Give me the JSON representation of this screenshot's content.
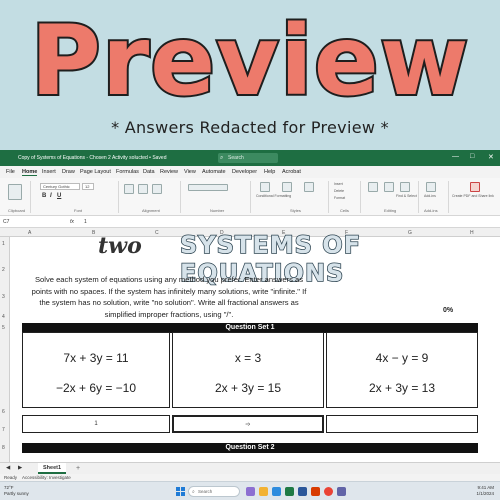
{
  "banner": {
    "title": "Preview",
    "subtitle": "* Answers Redacted for Preview *"
  },
  "window": {
    "doc_title": "Copy of Systems of Equations - Chosen 2 Activity solucted • Saved",
    "search_placeholder": "Search",
    "controls": [
      "—",
      "□",
      "✕"
    ]
  },
  "menu": {
    "tabs": [
      "File",
      "Home",
      "Insert",
      "Draw",
      "Page Layout",
      "Formulas",
      "Data",
      "Review",
      "View",
      "Automate",
      "Developer",
      "Help",
      "Acrobat"
    ],
    "active": "Home"
  },
  "ribbon": {
    "font_name": "Century Gothic",
    "font_size": "12",
    "groups": [
      "Clipboard",
      "Font",
      "Alignment",
      "Number",
      "Styles",
      "Cells",
      "Editing",
      "Add-ins"
    ],
    "buttons": [
      "Conditional Formatting",
      "Format as Table",
      "Cell Styles",
      "Insert",
      "Delete",
      "Format",
      "Sort & Filter",
      "Find & Select",
      "Add-ins",
      "Create PDF and Share link"
    ]
  },
  "formula_bar": {
    "cell_ref": "C7",
    "fx": "fx",
    "value": "1"
  },
  "columns": [
    "A",
    "B",
    "C",
    "D",
    "E",
    "F",
    "G",
    "H"
  ],
  "rows": [
    "1",
    "2",
    "3",
    "4",
    "5",
    "6",
    "7",
    "8"
  ],
  "worksheet": {
    "logo_text": "two",
    "title": "SYSTEMS OF EQUATIONS",
    "instructions": [
      "Solve each system of equations using any method you prefer. Enter answers as",
      "points with no spaces.  If the system has infinitely many solutions, write \"infinite.\" If",
      "the system has no solution, write \"no solution\".  Write all fractional answers as",
      "simplified improper fractions, using \"/\"."
    ],
    "percent": "0%",
    "question_sets": [
      "Question Set 1",
      "Question Set 2"
    ],
    "systems": [
      {
        "eq1": "7x + 3y = 11",
        "eq2": "−2x + 6y = −10",
        "answer": "1"
      },
      {
        "eq1": "x = 3",
        "eq2": "2x + 3y = 15",
        "answer": ""
      },
      {
        "eq1": "4x − y = 9",
        "eq2": "2x + 3y = 13",
        "answer": ""
      }
    ]
  },
  "sheet_tabs": {
    "active": "Sheet1",
    "add": "+"
  },
  "status": {
    "ready": "Ready",
    "accessibility": "Accessibility: Investigate"
  },
  "taskbar": {
    "weather_temp": "72°F",
    "weather_desc": "Partly sunny",
    "search": "Search",
    "time": "9:41 AM",
    "date": "1/1/2024"
  }
}
